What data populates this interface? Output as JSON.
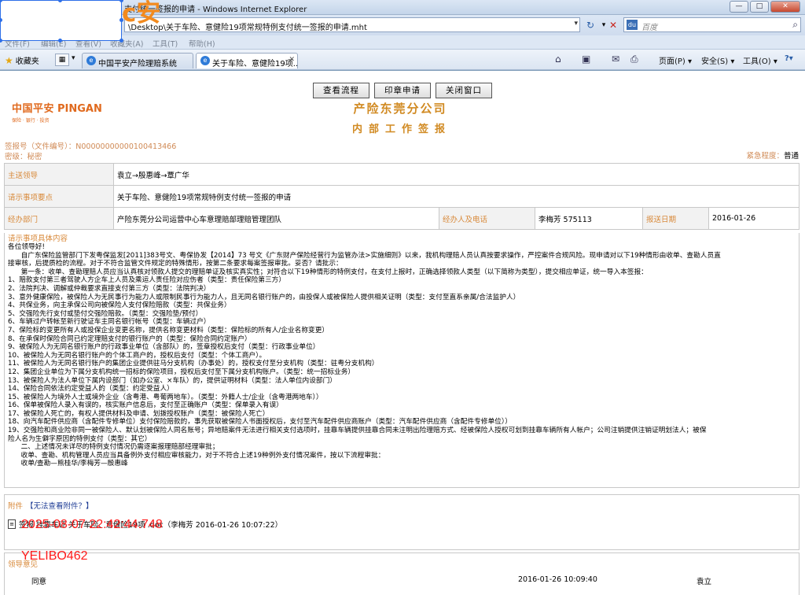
{
  "window": {
    "title": "支付统一签报的申请 - Windows Internet Explorer",
    "btn_min": "—",
    "btn_max": "□",
    "btn_close": "✕"
  },
  "address": {
    "url": "\\Desktop\\关于车险、意健险19项常规特例支付统一签报的申请.mht",
    "search_placeholder": "百度",
    "search_logo": "du"
  },
  "menu": [
    "文件(F)",
    "编辑(E)",
    "查看(V)",
    "收藏夹(A)",
    "工具(T)",
    "帮助(H)"
  ],
  "favorites_label": "收藏夹",
  "tabs": [
    {
      "label": "中国平安产险理赔系统"
    },
    {
      "label": "关于车险、意健险19项..."
    }
  ],
  "commands": {
    "page": "页面(P) ▾",
    "safety": "安全(S) ▾",
    "tools": "工具(O) ▾",
    "help": "?▾"
  },
  "buttons": {
    "view_flow": "查看流程",
    "seal_apply": "印章申请",
    "close_window": "关闭窗口"
  },
  "logo": {
    "cn": "中国平安",
    "en": "PINGAN",
    "tagline": "保险 · 银行 · 投资"
  },
  "org_name": "产险东莞分公司",
  "form_title": "内部工作签报",
  "doc": {
    "number_label": "签报号（文件编号）：",
    "number": "N00000000000100413466",
    "secret_label": "密级：",
    "secret": "秘密",
    "urgency_label": "紧急程度：",
    "urgency": "普通"
  },
  "info": {
    "leader_label": "主送领导",
    "leader": "袁立→殷惠峰→覃广华",
    "subject_label": "请示事项要点",
    "subject": "关于车险、意健险19项常规特例支付统一签报的申请",
    "dept_label": "经办部门",
    "dept": "产险东莞分公司运营中心车意理赔部理赔管理团队",
    "person_label": "经办人及电话",
    "person": "李梅芳 575113",
    "date_label": "报送日期",
    "date": "2016-01-26"
  },
  "content": {
    "header": "请示事项具体内容",
    "lines": [
      "各位领导好!",
      "      自广东保险监管部门下发粤保监发[2011]383号文、粤保协发【2014】73 号文《广东财产保险经营行为监管办法>实施细则》以来，我机构理赔人员认真按要求操作，严控案件合规风险。现申请对以下19种情形由收单、查勘人员直",
      "接审核，后提质检的流程。对于不符合监管文件规定的特殊情形，按第二条要求每案签报审批。妥否？请批示：",
      "      第一条：收单、查勘理赔人员应当认真核对领款人提交的理赔单证及核实真实性；对符合以下19种情形的特例支付，在支付上报时，正确选择领款人类型（以下简称为类型），提交相应单证，统一导入本签报：",
      "1、赔款支付第三者驾驶人方企车上人员及乘运人责任险对应伤者（类型：责任保险第三方）",
      "2、法院判决、调解或仲裁要求直接支付第三方（类型：法院判决）",
      "3、意外健康保险，被保险人为无民事行为能力人或限制民事行为能力人，且无同名银行账户的，由投保人或被保险人提供相关证明（类型：支付至直系亲属/合法监护人）",
      "4、共保业务，向主承保公司向被保险人支付保险赔款（类型：共保业务）",
      "5、交强险先行支付或垫付交强险赔款。（类型：交强险垫/预付）",
      "6、车辆过户转帐至新行驶证车主同名银行帐号（类型：车辆过户）",
      "7、保险标的变更所有人或投保企业变更名称，提供名称变更材料（类型：保险标的所有人/企业名称变更）",
      "8、在承保时保险合同已约定理赔支付的银行账户的（类型：保险合同约定账户）",
      "9、被保险人为无同名银行账户的行政事业单位（含部队）的，签章授权后支付（类型：行政事业单位）",
      "10、被保险人为无同名银行账户的个体工商户的，授权后支付（类型：个体工商户）。",
      "11、被保险人为无同名银行账户的集团企业提供驻马分支机构（办事处）的，授权支付至分支机构（类型：驻粤分支机构）",
      "12、集团企业单位为下属分支机构统一招标的保险项目，授权后支付至下属分支机构账户。（类型：统一招标业务）",
      "13、被保险人为法人单位下属内设部门（如办公室、×车队）的，提供证明材料（类型：法人单位内设部门）",
      "14、保险合同依法约定受益人的（类型：约定受益人）",
      "15、被保险人为境外人士或境外企业（含粤港、粤葡两地车）。（类型：外籍人士/企业（含粤港两地车））",
      "16、保单被保险人录入有误的，核实账户信息后，支付至正确账户（类型：保单录入有误）",
      "17、被保险人死亡的，有权人提供材料及申请、划拨授权账户（类型：被保险人死亡）",
      "18、向汽车配件供应商（含配件专修单位）支付保险赔款的，事先获取被保险人书面授权后，支付至汽车配件供应商账户（类型：汽车配件供应商（含配件专修单位））",
      "19、交强险和商业险非同一被保险人、默认划被保险人同名账号；异地赔案件无法进行相关支付选项时，挂靠车辆提供挂靠合同未注明出险理赔方式、经被保险人授权可划到挂靠车辆所有人帐户；公司注销提供注销证明划法人；被保",
      "险人名为生僻字原因的特例支付（类型：其它）",
      "      二、上述情况未详尽的特例支付情况仍需逐案报理赔部经理审批；",
      "      收单、查勘、机构管理人员应当具备例外支付相应审核能力，对于不符合上述19种例外支付情况案件，按以下流程审批：",
      "      收单/查勘—熊桂华/李梅芳—殷惠峰"
    ]
  },
  "attachment": {
    "label": "附件",
    "query": "【无法查看附件？】",
    "file": "签报 挂靠车证 关于车险、意健险19项 .doc（李梅芳 2016-01-26 10:07:22）"
  },
  "sign": {
    "header": "领导意见",
    "comment": "同意",
    "time": "2016-01-26 10:09:40",
    "signer": "袁立"
  },
  "overlays": {
    "logo_text": "c安",
    "timestamp": "2025-08-07 22:42:44.748",
    "watermark": "YELIBO462"
  }
}
